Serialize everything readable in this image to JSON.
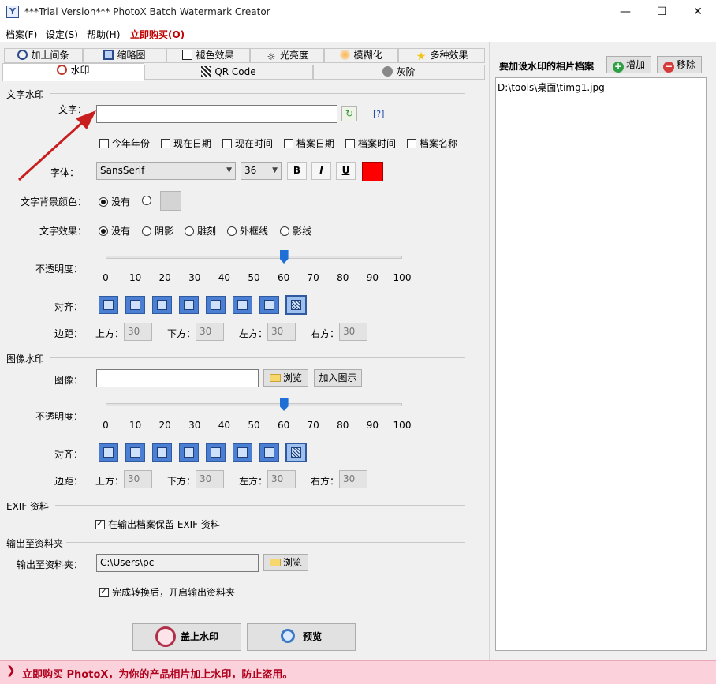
{
  "window": {
    "title": "***Trial Version*** PhotoX Batch Watermark Creator",
    "minimize": "—",
    "maximize": "☐",
    "close": "✕"
  },
  "menu": [
    "档案(F)",
    "设定(S)",
    "帮助(H)",
    "立即购买(O)"
  ],
  "tabs_row1": [
    "加上间条",
    "缩略图",
    "褪色效果",
    "光亮度",
    "模糊化",
    "多种效果"
  ],
  "tabs_row2": [
    "水印",
    "QR Code",
    "灰阶"
  ],
  "text_watermark": {
    "section": "文字水印",
    "text_label": "文字：",
    "text_value": "",
    "help": "[?]",
    "checkboxes": [
      "今年年份",
      "现在日期",
      "现在时间",
      "档案日期",
      "档案时间",
      "档案名称"
    ],
    "font_label": "字体：",
    "font_value": "SansSerif",
    "size_value": "36",
    "bold": "B",
    "italic": "I",
    "underline": "U",
    "font_color": "#ff0000",
    "bg_label": "文字背景颜色：",
    "bg_none": "没有",
    "effect_label": "文字效果：",
    "effects": [
      "没有",
      "阴影",
      "雕刻",
      "外框线",
      "影线"
    ],
    "opacity_label": "不透明度：",
    "opacity_value": 60,
    "ticks": [
      "0",
      "10",
      "20",
      "30",
      "40",
      "50",
      "60",
      "70",
      "80",
      "90",
      "100"
    ],
    "align_label": "对齐：",
    "margin_label": "边距：",
    "top_label": "上方：",
    "bottom_label": "下方：",
    "left_label": "左方：",
    "right_label": "右方：",
    "top_value": "30",
    "bottom_value": "30",
    "left_value": "30",
    "right_value": "30"
  },
  "image_watermark": {
    "section": "图像水印",
    "image_label": "图像：",
    "image_value": "",
    "browse": "浏览",
    "add_icon": "加入图示",
    "opacity_label": "不透明度：",
    "opacity_value": 60,
    "align_label": "对齐：",
    "margin_label": "边距：",
    "top_label": "上方：",
    "bottom_label": "下方：",
    "left_label": "左方：",
    "right_label": "右方：",
    "top_value": "30",
    "bottom_value": "30",
    "left_value": "30",
    "right_value": "30"
  },
  "exif": {
    "section": "EXIF 资料",
    "keep": "在输出档案保留 EXIF 资料"
  },
  "output": {
    "section": "输出至资料夹",
    "label": "输出至资料夹：",
    "path": "C:\\Users\\pc",
    "browse": "浏览",
    "open_after": "完成转换后，开启输出资料夹"
  },
  "actions": {
    "apply": "盖上水印",
    "preview": "预览"
  },
  "files": {
    "title": "要加设水印的相片档案",
    "add": "增加",
    "remove": "移除",
    "items": [
      "D:\\tools\\桌面\\timg1.jpg"
    ]
  },
  "footer": "立即购买 PhotoX，为你的产品相片加上水印，防止盗用。"
}
